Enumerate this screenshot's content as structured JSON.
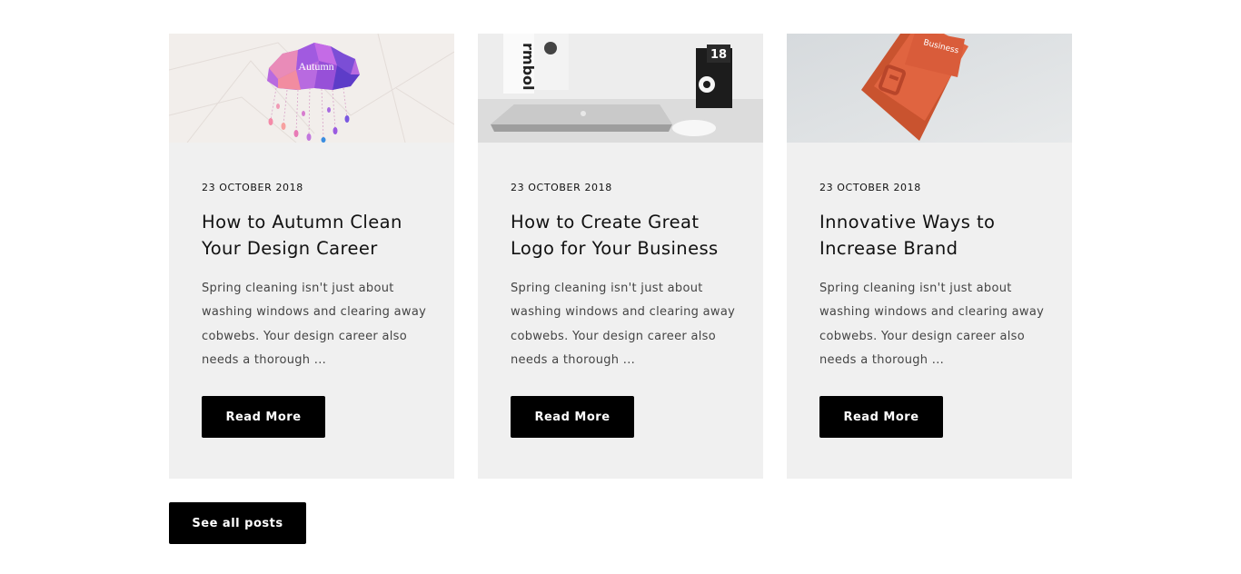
{
  "posts": [
    {
      "date": "23 OCTOBER 2018",
      "title": "How to Autumn Clean Your Design Career",
      "excerpt": "Spring cleaning isn't just about washing windows and clearing away cobwebs. Your design career also needs a thorough ...",
      "button": "Read More",
      "image_text": "Autumn"
    },
    {
      "date": "23 OCTOBER 2018",
      "title": "How to Create Great Logo for Your Business",
      "excerpt": "Spring cleaning isn't just about washing windows and clearing away cobwebs. Your design career also needs a thorough ...",
      "button": "Read More",
      "image_text": "18",
      "book_text": "rmbol"
    },
    {
      "date": "23 OCTOBER 2018",
      "title": "Innovative Ways to Increase Brand",
      "excerpt": "Spring cleaning isn't just about washing windows and clearing away cobwebs. Your design career also needs a thorough ...",
      "button": "Read More",
      "card_text": "Business"
    }
  ],
  "see_all": "See all posts",
  "colors": {
    "card_bg": "#f0f0f0",
    "button_bg": "#000000",
    "button_text": "#ffffff",
    "accent_orange": "#e0603f"
  }
}
